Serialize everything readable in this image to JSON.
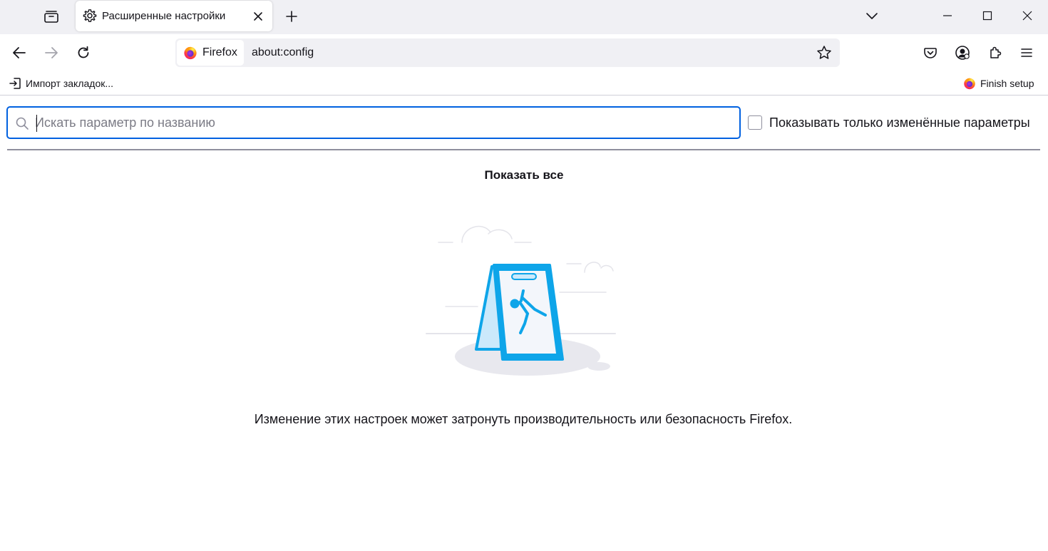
{
  "tab": {
    "title": "Расширенные настройки"
  },
  "urlbar": {
    "identity_label": "Firefox",
    "url": "about:config"
  },
  "bookmarks": {
    "import_label": "Импорт закладок...",
    "finish_label": "Finish setup"
  },
  "config": {
    "search_placeholder": "Искать параметр по названию",
    "search_value": "",
    "modified_only_label": "Показывать только изменённые параметры",
    "modified_only_checked": false,
    "show_all_label": "Показать все",
    "warning_text": "Изменение этих настроек может затронуть производительность или безопасность Firefox."
  },
  "icons": {
    "tab_list": "firefox-view-icon",
    "tab_favicon": "gear-icon",
    "tab_close": "close-icon",
    "new_tab": "plus-icon",
    "all_tabs": "chevron-down-icon",
    "back": "arrow-left-icon",
    "forward": "arrow-right-icon",
    "reload": "reload-icon",
    "bookmark": "star-icon",
    "pocket": "pocket-icon",
    "account": "account-icon",
    "extensions": "puzzle-icon",
    "menu": "hamburger-icon",
    "import": "import-icon",
    "search": "search-icon"
  },
  "colors": {
    "tabstrip_bg": "#f0f0f4",
    "focus_ring": "#0061e0",
    "illustration_blue": "#0ea5e9"
  }
}
